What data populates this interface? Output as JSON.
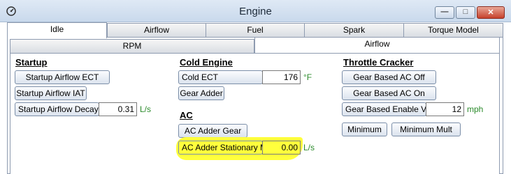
{
  "window": {
    "title": "Engine"
  },
  "colors": {
    "highlight": "#ffff33",
    "unit": "#2a8a2a"
  },
  "icons": {
    "app": "gauge-icon",
    "minimize": "minimize-icon",
    "maximize": "maximize-icon",
    "close": "close-icon"
  },
  "tabs": [
    "Idle",
    "Airflow",
    "Fuel",
    "Spark",
    "Torque Model"
  ],
  "active_tab": "Idle",
  "subtabs": [
    "RPM",
    "Airflow"
  ],
  "active_subtab": "Airflow",
  "startup": {
    "heading": "Startup",
    "airflow_ect": "Startup Airflow ECT",
    "airflow_iat": "Startup Airflow IAT",
    "airflow_decay": {
      "label": "Startup Airflow Decay",
      "value": "0.31",
      "unit": "L/s"
    }
  },
  "cold_engine": {
    "heading": "Cold Engine",
    "cold_ect": {
      "label": "Cold ECT",
      "value": "176",
      "unit": "°F"
    },
    "gear_adder": "Gear Adder"
  },
  "ac": {
    "heading": "AC",
    "adder_gear": "AC Adder Gear",
    "adder_stationary": {
      "label": "AC Adder Stationary Min",
      "value": "0.00",
      "unit": "L/s"
    }
  },
  "throttle_cracker": {
    "heading": "Throttle Cracker",
    "gear_ac_off": "Gear Based AC Off",
    "gear_ac_on": "Gear Based AC On",
    "gear_enable_vss": {
      "label": "Gear Based Enable VSS",
      "value": "12",
      "unit": "mph"
    },
    "minimum": "Minimum",
    "minimum_mult": "Minimum Mult"
  }
}
